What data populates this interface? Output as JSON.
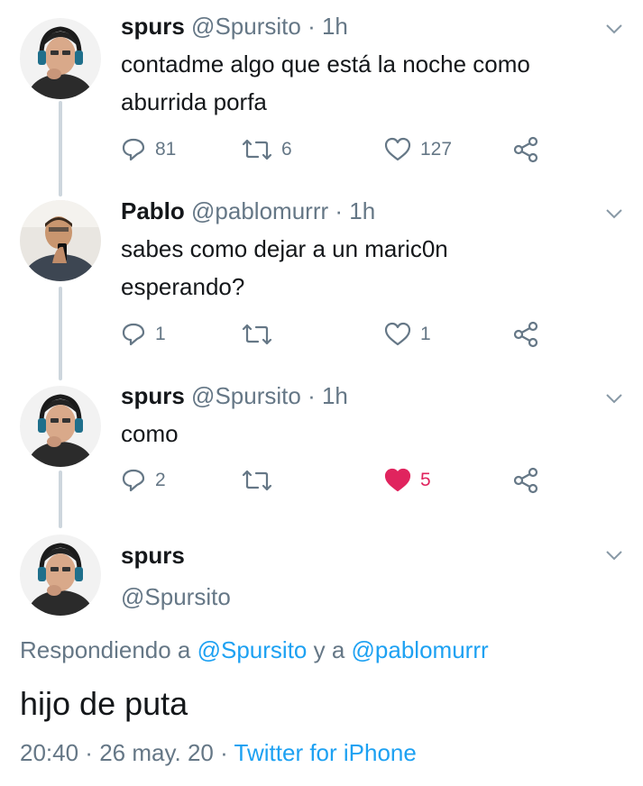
{
  "tweets": [
    {
      "name": "spurs",
      "handle": "@Spursito",
      "sep": "·",
      "time": "1h",
      "text_lines": [
        "contadme algo que está la noche como",
        "aburrida porfa"
      ],
      "replies": "81",
      "retweets": "6",
      "likes": "127",
      "liked": false
    },
    {
      "name": "Pablo",
      "handle": "@pablomurrr",
      "sep": "·",
      "time": "1h",
      "text_lines": [
        "sabes como dejar a un maric0n",
        "esperando?"
      ],
      "replies": "1",
      "retweets": "",
      "likes": "1",
      "liked": false
    },
    {
      "name": "spurs",
      "handle": "@Spursito",
      "sep": "·",
      "time": "1h",
      "text_lines": [
        "como"
      ],
      "replies": "2",
      "retweets": "",
      "likes": "5",
      "liked": true
    }
  ],
  "main": {
    "name": "spurs",
    "handle": "@Spursito",
    "replying_prefix": "Respondiendo a ",
    "mention1": "@Spursito",
    "connector": " y a ",
    "mention2": "@pablomurrr",
    "text": "hijo de puta",
    "time": "20:40",
    "sep1": " · ",
    "date": "26 may. 20",
    "sep2": " · ",
    "source": "Twitter for iPhone"
  },
  "colors": {
    "text": "#14171a",
    "muted": "#657786",
    "link": "#1da1f2",
    "like": "#e0245e",
    "thread_line": "#cdd6dd"
  },
  "icons": [
    "reply-icon",
    "retweet-icon",
    "like-icon",
    "share-icon",
    "chevron-down-icon"
  ]
}
